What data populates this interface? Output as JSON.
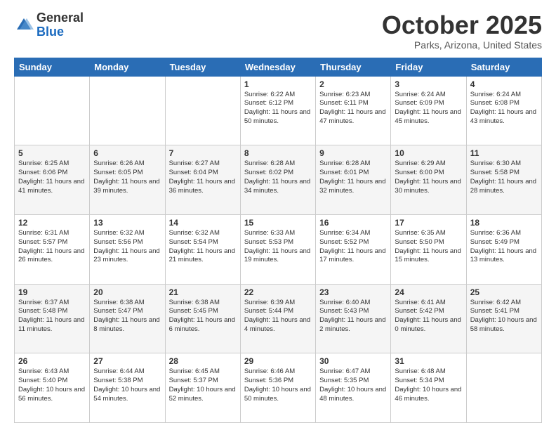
{
  "logo": {
    "general": "General",
    "blue": "Blue"
  },
  "header": {
    "month": "October 2025",
    "location": "Parks, Arizona, United States"
  },
  "days_of_week": [
    "Sunday",
    "Monday",
    "Tuesday",
    "Wednesday",
    "Thursday",
    "Friday",
    "Saturday"
  ],
  "weeks": [
    [
      {
        "day": "",
        "sunrise": "",
        "sunset": "",
        "daylight": ""
      },
      {
        "day": "",
        "sunrise": "",
        "sunset": "",
        "daylight": ""
      },
      {
        "day": "",
        "sunrise": "",
        "sunset": "",
        "daylight": ""
      },
      {
        "day": "1",
        "sunrise": "Sunrise: 6:22 AM",
        "sunset": "Sunset: 6:12 PM",
        "daylight": "Daylight: 11 hours and 50 minutes."
      },
      {
        "day": "2",
        "sunrise": "Sunrise: 6:23 AM",
        "sunset": "Sunset: 6:11 PM",
        "daylight": "Daylight: 11 hours and 47 minutes."
      },
      {
        "day": "3",
        "sunrise": "Sunrise: 6:24 AM",
        "sunset": "Sunset: 6:09 PM",
        "daylight": "Daylight: 11 hours and 45 minutes."
      },
      {
        "day": "4",
        "sunrise": "Sunrise: 6:24 AM",
        "sunset": "Sunset: 6:08 PM",
        "daylight": "Daylight: 11 hours and 43 minutes."
      }
    ],
    [
      {
        "day": "5",
        "sunrise": "Sunrise: 6:25 AM",
        "sunset": "Sunset: 6:06 PM",
        "daylight": "Daylight: 11 hours and 41 minutes."
      },
      {
        "day": "6",
        "sunrise": "Sunrise: 6:26 AM",
        "sunset": "Sunset: 6:05 PM",
        "daylight": "Daylight: 11 hours and 39 minutes."
      },
      {
        "day": "7",
        "sunrise": "Sunrise: 6:27 AM",
        "sunset": "Sunset: 6:04 PM",
        "daylight": "Daylight: 11 hours and 36 minutes."
      },
      {
        "day": "8",
        "sunrise": "Sunrise: 6:28 AM",
        "sunset": "Sunset: 6:02 PM",
        "daylight": "Daylight: 11 hours and 34 minutes."
      },
      {
        "day": "9",
        "sunrise": "Sunrise: 6:28 AM",
        "sunset": "Sunset: 6:01 PM",
        "daylight": "Daylight: 11 hours and 32 minutes."
      },
      {
        "day": "10",
        "sunrise": "Sunrise: 6:29 AM",
        "sunset": "Sunset: 6:00 PM",
        "daylight": "Daylight: 11 hours and 30 minutes."
      },
      {
        "day": "11",
        "sunrise": "Sunrise: 6:30 AM",
        "sunset": "Sunset: 5:58 PM",
        "daylight": "Daylight: 11 hours and 28 minutes."
      }
    ],
    [
      {
        "day": "12",
        "sunrise": "Sunrise: 6:31 AM",
        "sunset": "Sunset: 5:57 PM",
        "daylight": "Daylight: 11 hours and 26 minutes."
      },
      {
        "day": "13",
        "sunrise": "Sunrise: 6:32 AM",
        "sunset": "Sunset: 5:56 PM",
        "daylight": "Daylight: 11 hours and 23 minutes."
      },
      {
        "day": "14",
        "sunrise": "Sunrise: 6:32 AM",
        "sunset": "Sunset: 5:54 PM",
        "daylight": "Daylight: 11 hours and 21 minutes."
      },
      {
        "day": "15",
        "sunrise": "Sunrise: 6:33 AM",
        "sunset": "Sunset: 5:53 PM",
        "daylight": "Daylight: 11 hours and 19 minutes."
      },
      {
        "day": "16",
        "sunrise": "Sunrise: 6:34 AM",
        "sunset": "Sunset: 5:52 PM",
        "daylight": "Daylight: 11 hours and 17 minutes."
      },
      {
        "day": "17",
        "sunrise": "Sunrise: 6:35 AM",
        "sunset": "Sunset: 5:50 PM",
        "daylight": "Daylight: 11 hours and 15 minutes."
      },
      {
        "day": "18",
        "sunrise": "Sunrise: 6:36 AM",
        "sunset": "Sunset: 5:49 PM",
        "daylight": "Daylight: 11 hours and 13 minutes."
      }
    ],
    [
      {
        "day": "19",
        "sunrise": "Sunrise: 6:37 AM",
        "sunset": "Sunset: 5:48 PM",
        "daylight": "Daylight: 11 hours and 11 minutes."
      },
      {
        "day": "20",
        "sunrise": "Sunrise: 6:38 AM",
        "sunset": "Sunset: 5:47 PM",
        "daylight": "Daylight: 11 hours and 8 minutes."
      },
      {
        "day": "21",
        "sunrise": "Sunrise: 6:38 AM",
        "sunset": "Sunset: 5:45 PM",
        "daylight": "Daylight: 11 hours and 6 minutes."
      },
      {
        "day": "22",
        "sunrise": "Sunrise: 6:39 AM",
        "sunset": "Sunset: 5:44 PM",
        "daylight": "Daylight: 11 hours and 4 minutes."
      },
      {
        "day": "23",
        "sunrise": "Sunrise: 6:40 AM",
        "sunset": "Sunset: 5:43 PM",
        "daylight": "Daylight: 11 hours and 2 minutes."
      },
      {
        "day": "24",
        "sunrise": "Sunrise: 6:41 AM",
        "sunset": "Sunset: 5:42 PM",
        "daylight": "Daylight: 11 hours and 0 minutes."
      },
      {
        "day": "25",
        "sunrise": "Sunrise: 6:42 AM",
        "sunset": "Sunset: 5:41 PM",
        "daylight": "Daylight: 10 hours and 58 minutes."
      }
    ],
    [
      {
        "day": "26",
        "sunrise": "Sunrise: 6:43 AM",
        "sunset": "Sunset: 5:40 PM",
        "daylight": "Daylight: 10 hours and 56 minutes."
      },
      {
        "day": "27",
        "sunrise": "Sunrise: 6:44 AM",
        "sunset": "Sunset: 5:38 PM",
        "daylight": "Daylight: 10 hours and 54 minutes."
      },
      {
        "day": "28",
        "sunrise": "Sunrise: 6:45 AM",
        "sunset": "Sunset: 5:37 PM",
        "daylight": "Daylight: 10 hours and 52 minutes."
      },
      {
        "day": "29",
        "sunrise": "Sunrise: 6:46 AM",
        "sunset": "Sunset: 5:36 PM",
        "daylight": "Daylight: 10 hours and 50 minutes."
      },
      {
        "day": "30",
        "sunrise": "Sunrise: 6:47 AM",
        "sunset": "Sunset: 5:35 PM",
        "daylight": "Daylight: 10 hours and 48 minutes."
      },
      {
        "day": "31",
        "sunrise": "Sunrise: 6:48 AM",
        "sunset": "Sunset: 5:34 PM",
        "daylight": "Daylight: 10 hours and 46 minutes."
      },
      {
        "day": "",
        "sunrise": "",
        "sunset": "",
        "daylight": ""
      }
    ]
  ]
}
